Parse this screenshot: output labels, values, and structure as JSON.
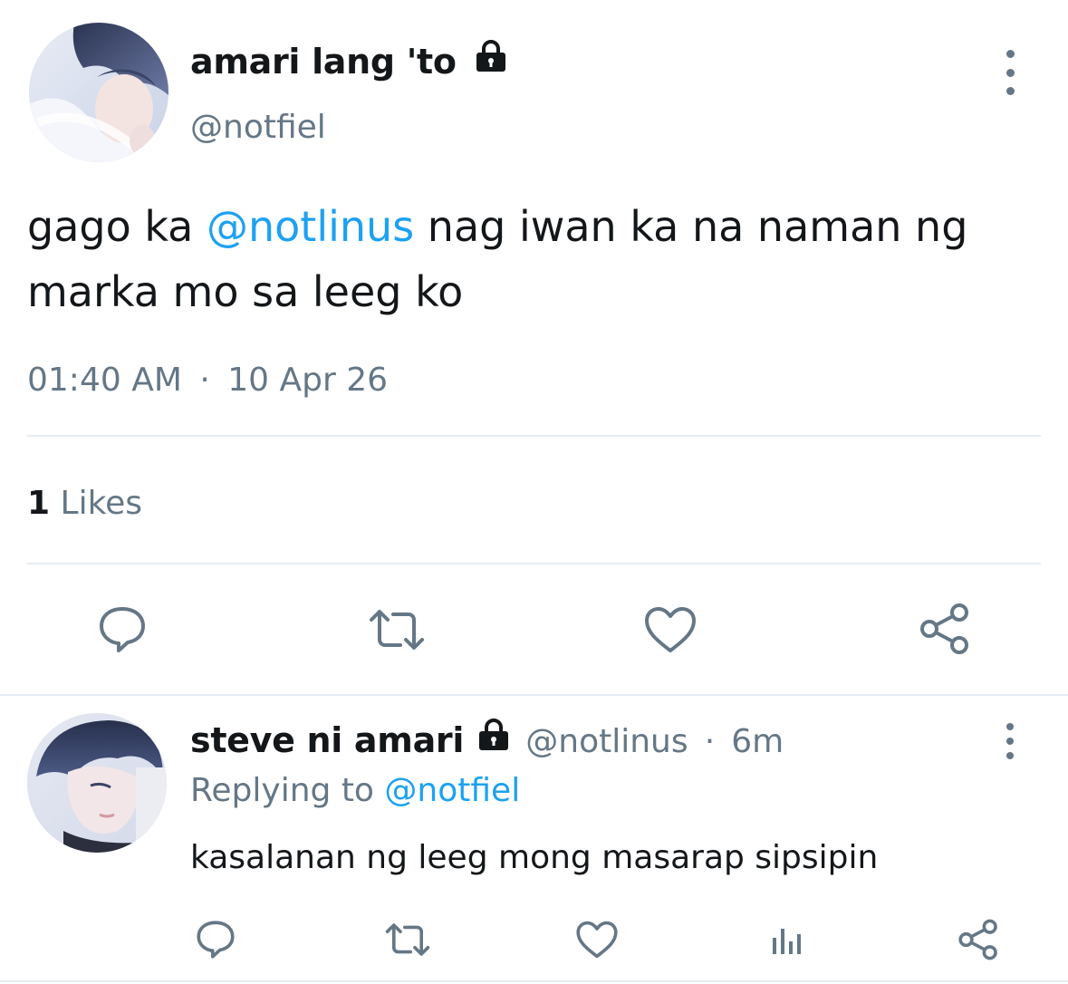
{
  "tweet": {
    "display_name": "amari lang 'to",
    "handle": "@notfiel",
    "text_before_mention": "gago ka ",
    "mention": "@notlinus",
    "text_after_mention_line1": " nag iwan ka na naman ng",
    "text_line2": "marka mo sa leeg ko",
    "time": "01:40 AM",
    "separator": "·",
    "date": "10 Apr 26",
    "likes_count": "1",
    "likes_label": "Likes"
  },
  "reply": {
    "display_name": "steve ni amari",
    "handle": "@notlinus",
    "separator": "·",
    "age": "6m",
    "replying_prefix": "Replying to",
    "replying_to": "@notfiel",
    "text": "kasalanan ng leeg mong masarap sipsipin"
  },
  "icons": {
    "lock": "lock-icon",
    "more": "more-vertical-icon",
    "reply": "comment-icon",
    "retweet": "retweet-icon",
    "like": "heart-icon",
    "share": "share-icon",
    "stats": "stats-icon"
  },
  "colors": {
    "accent": "#1da1f2",
    "muted": "#657786",
    "text": "#14171a",
    "divider": "#e6ecf0"
  }
}
